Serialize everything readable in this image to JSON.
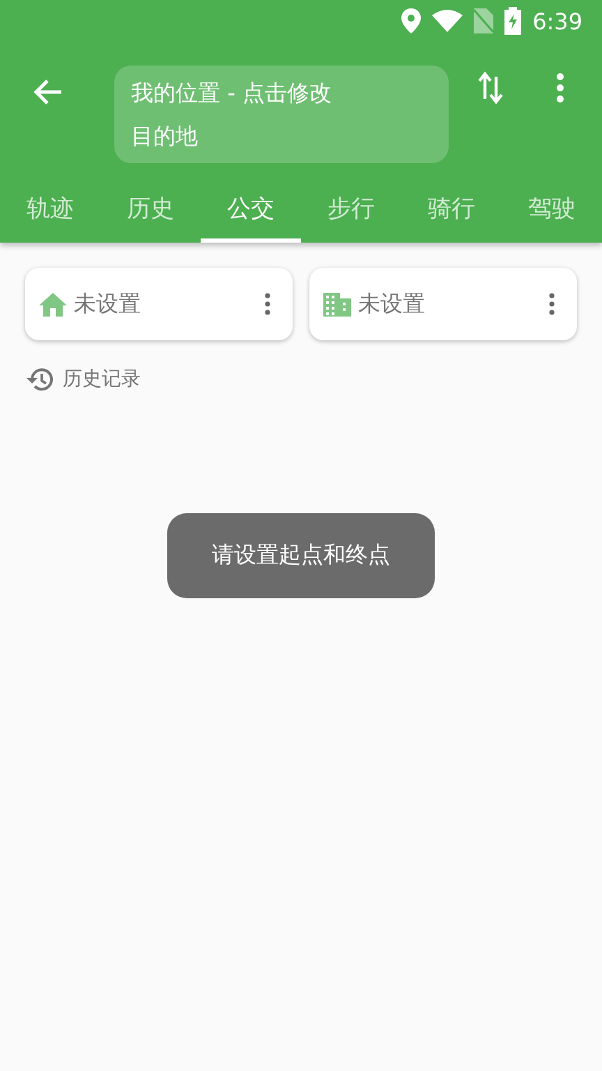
{
  "status_bar": {
    "time": "6:39"
  },
  "route": {
    "origin": "我的位置 - 点击修改",
    "destination": "目的地"
  },
  "tabs": [
    {
      "label": "轨迹",
      "selected": false
    },
    {
      "label": "历史",
      "selected": false
    },
    {
      "label": "公交",
      "selected": true
    },
    {
      "label": "步行",
      "selected": false
    },
    {
      "label": "骑行",
      "selected": false
    },
    {
      "label": "驾驶",
      "selected": false
    }
  ],
  "places": [
    {
      "kind": "home",
      "label": "未设置"
    },
    {
      "kind": "work",
      "label": "未设置"
    }
  ],
  "history": {
    "label": "历史记录"
  },
  "toast": {
    "text": "请设置起点和终点"
  }
}
